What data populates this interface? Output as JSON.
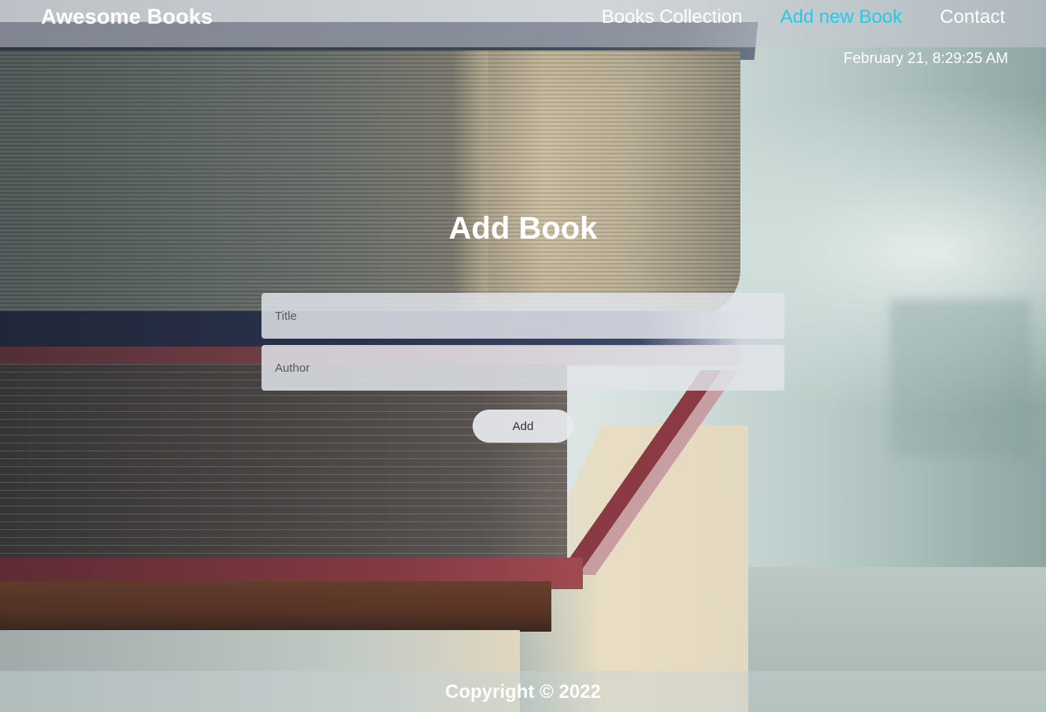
{
  "header": {
    "brand": "Awesome Books",
    "nav": [
      {
        "label": "Books Collection",
        "active": false
      },
      {
        "label": "Add new Book",
        "active": true
      },
      {
        "label": "Contact",
        "active": false
      }
    ],
    "datetime": "February 21, 8:29:25 AM"
  },
  "main": {
    "heading": "Add Book",
    "title_field": {
      "placeholder": "Title",
      "value": ""
    },
    "author_field": {
      "placeholder": "Author",
      "value": ""
    },
    "add_button": "Add"
  },
  "footer": {
    "copyright": "Copyright © 2022"
  },
  "colors": {
    "active_link": "#28c8e6",
    "text": "#ffffff"
  }
}
